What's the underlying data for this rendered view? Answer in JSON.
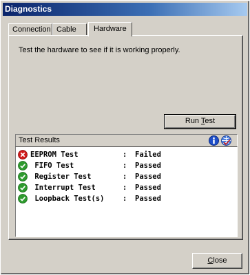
{
  "window": {
    "title": "Diagnostics"
  },
  "tabs": [
    {
      "label": "Connection"
    },
    {
      "label": "Cable"
    },
    {
      "label": "Hardware"
    }
  ],
  "hardware": {
    "description": "Test the hardware to see if it is working properly.",
    "run_button_prefix": "Run ",
    "run_button_hotkey": "T",
    "run_button_suffix": "est"
  },
  "results": {
    "title": "Test Results",
    "rows": [
      {
        "name": "EEPROM Test",
        "sep": ":",
        "status": "Failed",
        "icon": "error-icon"
      },
      {
        "name": " FIFO Test",
        "sep": ":",
        "status": "Passed",
        "icon": "check-icon"
      },
      {
        "name": " Register Test",
        "sep": ":",
        "status": "Passed",
        "icon": "check-icon"
      },
      {
        "name": " Interrupt Test",
        "sep": ":",
        "status": "Passed",
        "icon": "check-icon"
      },
      {
        "name": " Loopback Test(s)",
        "sep": ":",
        "status": "Passed",
        "icon": "check-icon"
      }
    ]
  },
  "footer": {
    "close_hotkey": "C",
    "close_suffix": "lose"
  },
  "colors": {
    "face": "#d4d0c8",
    "title_start": "#0a246a",
    "title_end": "#a6caf0",
    "error": "#d11a1a",
    "pass": "#2e9b2e"
  }
}
